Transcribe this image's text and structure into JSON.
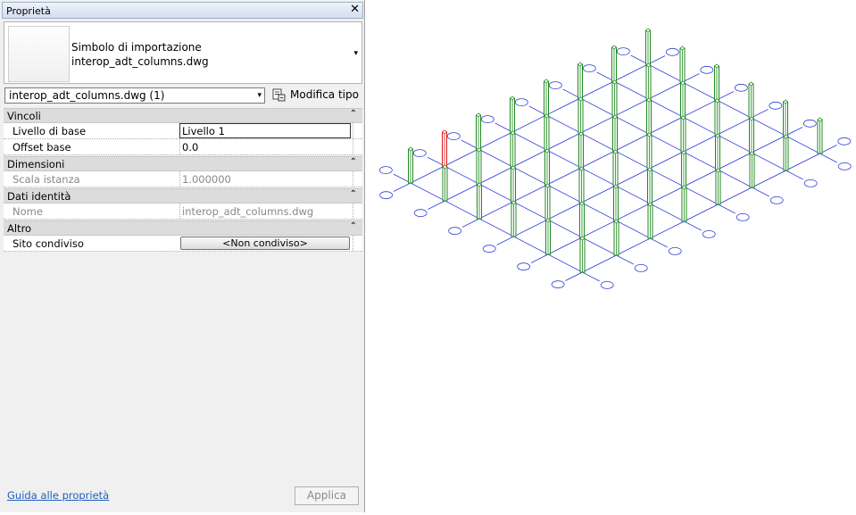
{
  "panel": {
    "title": "Proprietà",
    "close_glyph": "✕",
    "type_selector": {
      "line1": "Simbolo di importazione",
      "line2": "interop_adt_columns.dwg",
      "arrow": "▾"
    },
    "instance_selector": {
      "value": "interop_adt_columns.dwg (1)",
      "arrow": "▾"
    },
    "edit_type_label": "Modifica tipo",
    "groups": [
      {
        "name": "Vincoli",
        "rows": [
          {
            "key": "Livello di base",
            "value": "Livello 1"
          },
          {
            "key": "Offset base",
            "value": "0.0"
          }
        ]
      },
      {
        "name": "Dimensioni",
        "rows": [
          {
            "key": "Scala istanza",
            "value": "1.000000"
          }
        ]
      },
      {
        "name": "Dati identità",
        "rows": [
          {
            "key": "Nome",
            "value": "interop_adt_columns.dwg"
          }
        ]
      },
      {
        "name": "Altro",
        "rows": [
          {
            "key": "Sito condiviso",
            "value": "<Non condiviso>"
          }
        ]
      }
    ],
    "collapse_glyph": "⌃",
    "help_link": "Guida alle proprietà",
    "apply_label": "Applica"
  },
  "viewport": {
    "grid_color": "#2f3fd8",
    "column_color": "#1e8a1e",
    "selected_column_color": "#d81818",
    "grid_rows": 6,
    "grid_cols": 8,
    "selected_column": {
      "row": 0,
      "col": 1
    }
  }
}
